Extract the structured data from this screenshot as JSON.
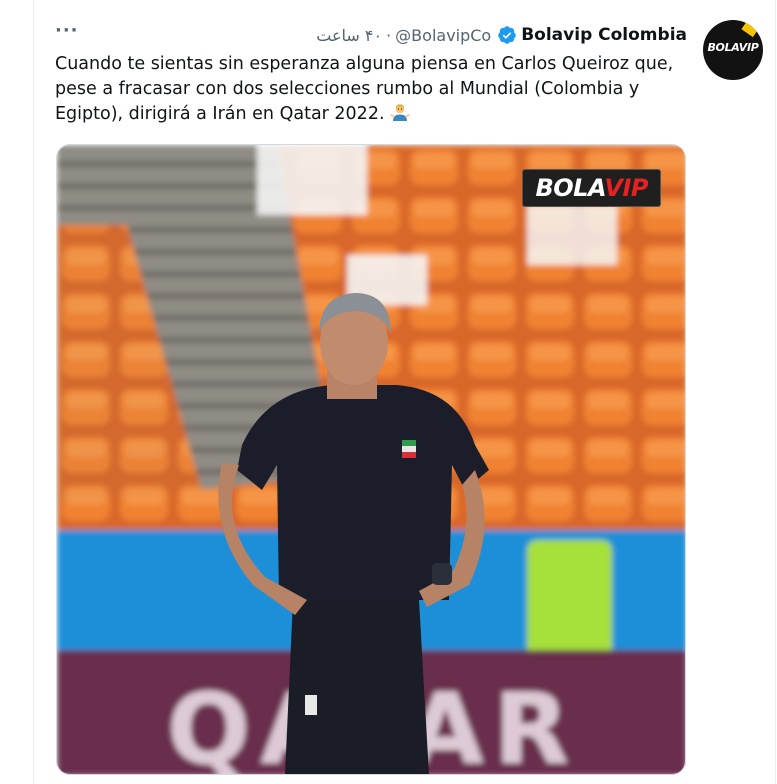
{
  "tweet": {
    "author_name": "Bolavip Colombia",
    "handle": "@BolavipCo",
    "time_separator": "·",
    "time": "۴۰ ساعت",
    "verified": true,
    "text": "Cuando te sientas sin esperanza alguna piensa en Carlos Queiroz que, pese a fracasar con dos selecciones rumbo al Mundial (Colombia y Egipto), dirigirá a Irán en Qatar 2022.",
    "emoji": "man-shrugging-emoji",
    "more_menu": "···"
  },
  "avatar": {
    "logo_text": "BOLAVIP",
    "accent_color": "#f5c400"
  },
  "media": {
    "watermark_a": "BOLA",
    "watermark_b": "VIP",
    "banner_text": "QATAR",
    "colors": {
      "seats": "#e8742a",
      "shirt": "#1b1e2a",
      "wall": "#1f8fd8",
      "banner": "#6b2f4d"
    }
  },
  "colors": {
    "verified_badge": "#1d9bf0",
    "secondary_text": "#536471",
    "primary_text": "#0f1419"
  }
}
